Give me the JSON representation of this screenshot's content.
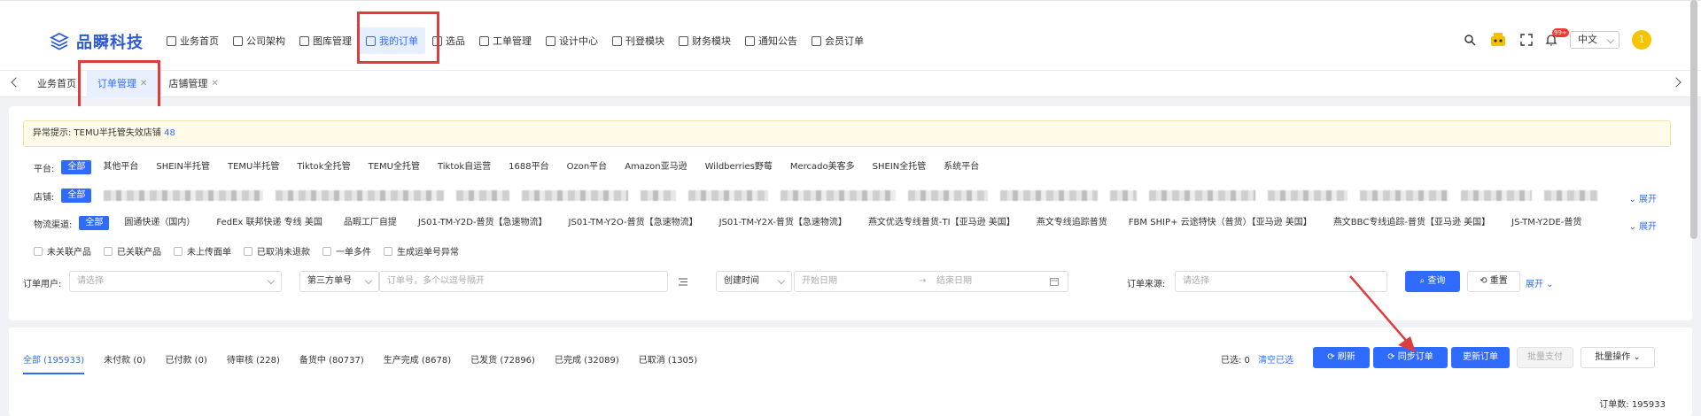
{
  "brand": {
    "name": "品瞬科技"
  },
  "nav": [
    {
      "label": "业务首页",
      "icon": "home-icon"
    },
    {
      "label": "公司架构",
      "icon": "org-icon"
    },
    {
      "label": "图库管理",
      "icon": "image-icon"
    },
    {
      "label": "我的订单",
      "icon": "grid-icon",
      "active": true
    },
    {
      "label": "选品",
      "icon": "table-icon"
    },
    {
      "label": "工单管理",
      "icon": "edit-icon"
    },
    {
      "label": "设计中心",
      "icon": "design-icon"
    },
    {
      "label": "刊登模块",
      "icon": "publish-icon"
    },
    {
      "label": "财务模块",
      "icon": "finance-icon"
    },
    {
      "label": "通知公告",
      "icon": "notice-icon"
    },
    {
      "label": "会员订单",
      "icon": "member-icon"
    }
  ],
  "header_tools": {
    "language": "中文",
    "badge": "99+",
    "avatar_text": "1"
  },
  "tabs": [
    {
      "label": "业务首页",
      "closable": false
    },
    {
      "label": "订单管理",
      "closable": true,
      "active": true
    },
    {
      "label": "店铺管理",
      "closable": true
    }
  ],
  "alert": {
    "label": "异常提示: TEMU半托管失效店铺",
    "count": "48"
  },
  "filters": {
    "platform_label": "平台:",
    "platforms": [
      "全部",
      "其他平台",
      "SHEIN半托管",
      "TEMU半托管",
      "Tiktok全托管",
      "TEMU全托管",
      "Tiktok自运营",
      "1688平台",
      "Ozon平台",
      "Amazon亚马逊",
      "Wildberries野莓",
      "Mercado美客多",
      "SHEIN全托管",
      "系统平台"
    ],
    "store_label": "店铺:",
    "store_all": "全部",
    "logistics_label": "物流渠道:",
    "logistics": [
      "全部",
      "圆通快递（国内）",
      "FedEx 联邦快递 专线 美国",
      "品暇工厂自提",
      "JS01-TM-Y2D-普货【急速物流】",
      "JS01-TM-Y2O-普货【急速物流】",
      "JS01-TM-Y2X-普货【急速物流】",
      "燕文优选专线普货-TI【亚马逊 美国】",
      "燕文专线追踪普货",
      "FBM SHIP+ 云途特快（普货）【亚马逊 美国】",
      "燕文BBC专线追踪-普货【亚马逊 美国】",
      "JS-TM-Y2DE-普货"
    ],
    "expand": "展开",
    "checkboxes": [
      "未关联产品",
      "已关联产品",
      "未上传面单",
      "已取消未退款",
      "一单多件",
      "生成运单号异常"
    ],
    "order_user_label": "订单用户:",
    "order_user_placeholder": "请选择",
    "third_party": "第三方单号",
    "order_no_placeholder": "订单号，多个以逗号隔开",
    "time_type": "创建时间",
    "start_date": "开始日期",
    "end_date": "结束日期",
    "source_label": "订单来源:",
    "source_placeholder": "请选择",
    "query": "查询",
    "reset": "重置",
    "more": "展开"
  },
  "status_tabs": [
    {
      "label": "全部 (195933)",
      "active": true
    },
    {
      "label": "未付款 (0)"
    },
    {
      "label": "已付款 (0)"
    },
    {
      "label": "待审核 (228)"
    },
    {
      "label": "备货中 (80737)"
    },
    {
      "label": "生产完成 (8678)"
    },
    {
      "label": "已发货 (72896)"
    },
    {
      "label": "已完成 (32089)"
    },
    {
      "label": "已取消 (1305)"
    }
  ],
  "actions": {
    "selected": "已选: 0",
    "clear": "清空已选",
    "refresh": "刷新",
    "sync": "同步订单",
    "update": "更新订单",
    "batch_pay": "批量支付",
    "batch_ops": "批量操作"
  },
  "total": "订单数: 195933",
  "colors": {
    "primary": "#2f6bff",
    "highlight": "#e03c3c"
  }
}
